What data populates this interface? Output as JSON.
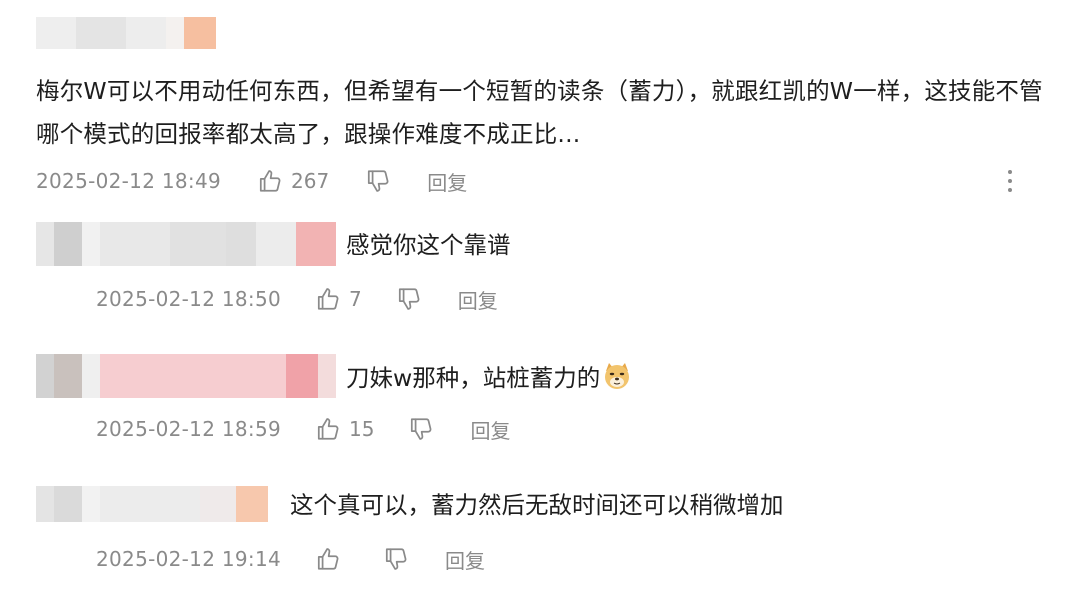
{
  "main_comment": {
    "text": "梅尔W可以不用动任何东西，但希望有一个短暂的读条（蓄力），就跟红凯的W一样，这技能不管哪个模式的回报率都太高了，跟操作难度不成正比...",
    "timestamp": "2025-02-12 18:49",
    "like_count": "267",
    "reply_label": "回复",
    "more_icon": "more-vertical-icon"
  },
  "replies": [
    {
      "text": "感觉你这个靠谱",
      "timestamp": "2025-02-12 18:50",
      "like_count": "7",
      "reply_label": "回复"
    },
    {
      "text": "刀妹w那种，站桩蓄力的",
      "emoji": "doge-emoji",
      "timestamp": "2025-02-12 18:59",
      "like_count": "15",
      "reply_label": "回复"
    },
    {
      "text": "这个真可以，蓄力然后无敌时间还可以稍微增加",
      "timestamp": "2025-02-12 19:14",
      "like_count": "",
      "reply_label": "回复"
    }
  ],
  "colors": {
    "text": "#1e1e1e",
    "meta": "#8a8a8a",
    "icon": "#8a8a8a",
    "redaction_pink": "#f3a8ad",
    "redaction_orange": "#f6c09f",
    "redaction_gray": "#d9d9d9"
  }
}
